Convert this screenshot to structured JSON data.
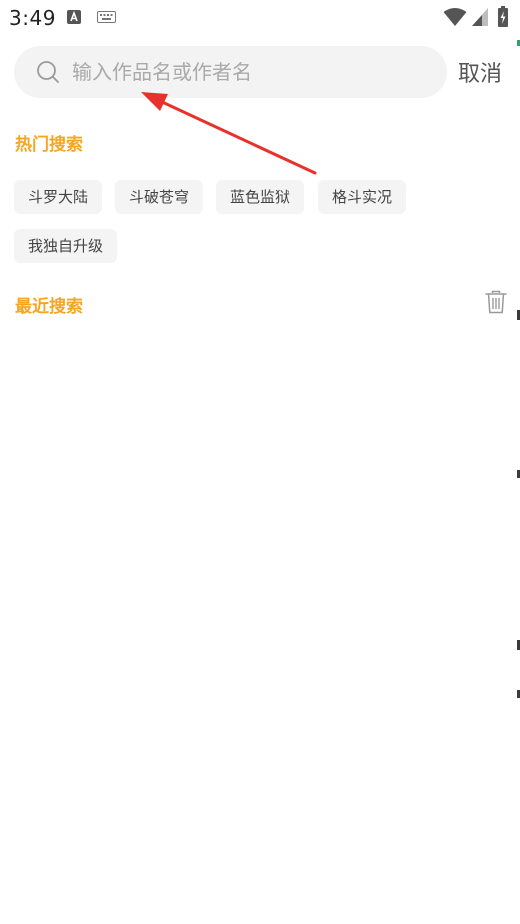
{
  "status_bar": {
    "time": "3:49",
    "icons": [
      "a-notification-icon",
      "keyboard-icon",
      "wifi-icon",
      "signal-icon",
      "battery-charging-icon"
    ]
  },
  "search": {
    "placeholder": "输入作品名或作者名",
    "value": "",
    "cancel_label": "取消"
  },
  "hot_search": {
    "title": "热门搜索",
    "tags": [
      "斗罗大陆",
      "斗破苍穹",
      "蓝色监狱",
      "格斗实况",
      "我独自升级"
    ]
  },
  "recent_search": {
    "title": "最近搜索",
    "items": []
  },
  "colors": {
    "accent": "#f5a623",
    "annotation_arrow": "#e8312a",
    "search_bg": "#f3f3f3",
    "tag_bg": "#f4f4f4"
  }
}
